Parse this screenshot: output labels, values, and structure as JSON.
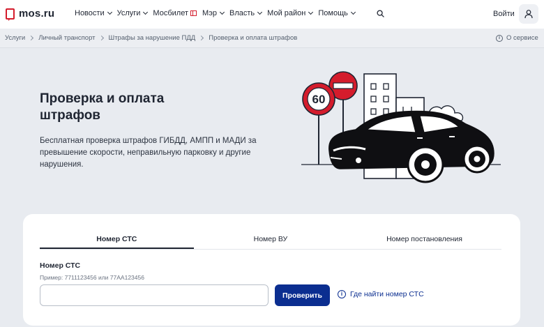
{
  "header": {
    "logo_text": "mos.ru",
    "nav": [
      {
        "label": "Новости",
        "dropdown": true
      },
      {
        "label": "Услуги",
        "dropdown": true
      },
      {
        "label": "Мосбилет",
        "dropdown": false
      },
      {
        "label": "Мэр",
        "dropdown": true
      },
      {
        "label": "Власть",
        "dropdown": true
      },
      {
        "label": "Мой район",
        "dropdown": true
      },
      {
        "label": "Помощь",
        "dropdown": true
      }
    ],
    "login_label": "Войти"
  },
  "breadcrumbs": [
    "Услуги",
    "Личный транспорт",
    "Штрафы за нарушение ПДД",
    "Проверка и оплата штрафов"
  ],
  "about_label": "О сервисе",
  "hero": {
    "title": "Проверка и оплата штрафов",
    "description": "Бесплатная проверка штрафов ГИБДД, АМПП и МАДИ за превышение скорости, неправильную парковку и другие нарушения.",
    "speed_sign": "60"
  },
  "form": {
    "tabs": [
      {
        "label": "Номер СТС",
        "active": true
      },
      {
        "label": "Номер ВУ",
        "active": false
      },
      {
        "label": "Номер постановления",
        "active": false
      }
    ],
    "field_label": "Номер СТС",
    "field_hint": "Пример: 7711123456 или 77АА123456",
    "field_value": "",
    "field_placeholder": "",
    "submit_label": "Проверить",
    "help_link": "Где найти номер СТС"
  },
  "colors": {
    "brand_red": "#d41c2c",
    "primary_blue": "#0b2e90",
    "page_bg": "#e8ebf0"
  }
}
